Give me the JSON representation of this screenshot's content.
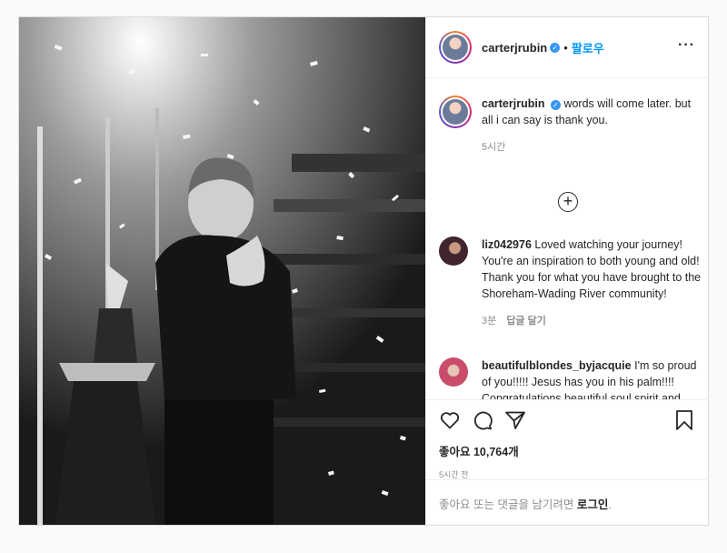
{
  "header": {
    "username": "carterjrubin",
    "follow_label": "팔로우",
    "separator": "•",
    "more_label": "···"
  },
  "caption": {
    "username": "carterjrubin",
    "text": "words will come later. but all i can say is thank you.",
    "time": "5시간"
  },
  "comments": [
    {
      "username": "liz042976",
      "text": "Loved watching your journey! You're an inspiration to both young and old! Thank you for what you have brought to the Shoreham-Wading River community!",
      "time": "3분",
      "reply_label": "답글 달기"
    },
    {
      "username": "beautifulblondes_byjacquie",
      "text": "I'm so proud of you!!!!! Jesus has you in his palm!!!! Congratulations beautiful soul spirit and voice!!!!"
    }
  ],
  "load_more_icon": "plus-circle-icon",
  "actions": {
    "likes_text": "좋아요 10,764개",
    "time_text": "5시간 전"
  },
  "login_prompt": {
    "text": "좋아요 또는 댓글을 남기려면",
    "link": "로그인",
    "suffix": "."
  },
  "colors": {
    "link": "#0095f6",
    "verified": "#3897f0"
  }
}
